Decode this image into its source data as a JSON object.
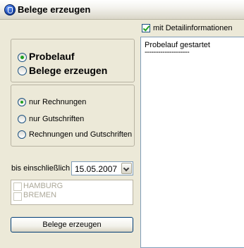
{
  "window": {
    "title": "Belege erzeugen"
  },
  "detail_checkbox": {
    "label": "mit Detailinformationen",
    "checked": true
  },
  "mode_group": {
    "options": [
      {
        "label": "Probelauf",
        "checked": true
      },
      {
        "label": "Belege erzeugen",
        "checked": false
      }
    ]
  },
  "type_group": {
    "options": [
      {
        "label": "nur Rechnungen",
        "checked": true
      },
      {
        "label": "nur Gutschriften",
        "checked": false
      },
      {
        "label": "Rechnungen und Gutschriften",
        "checked": false
      }
    ]
  },
  "date": {
    "label": "bis einschließlich",
    "value": "15.05.2007"
  },
  "locations": {
    "items": [
      {
        "label": "HAMBURG",
        "checked": false,
        "enabled": false
      },
      {
        "label": "BREMEN",
        "checked": false,
        "enabled": false
      }
    ]
  },
  "log": {
    "lines": [
      "Probelauf gestartet",
      "--------------------"
    ]
  },
  "action_button": {
    "label": "Belege erzeugen"
  }
}
